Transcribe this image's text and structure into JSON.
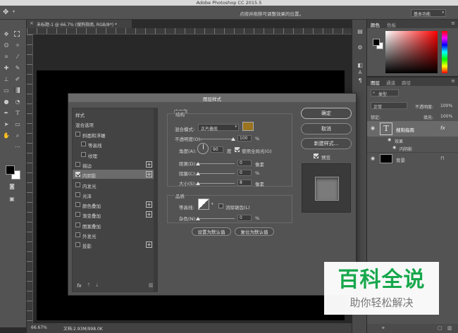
{
  "app": {
    "title": "Adobe Photoshop CC 2015.5",
    "hint": "点按并拖移可调整效果的位置。",
    "workspace": "基本功能"
  },
  "document": {
    "tab": "未标题-1 @ 66.7% (搜狗指南, RGB/8*) *",
    "zoom": "66.67%",
    "status": "文档:2.93M/998.0K"
  },
  "dialog": {
    "title": "图层样式",
    "styles_header": "样式",
    "blend_options": "混合选项",
    "effects": [
      {
        "label": "斜面和浮雕",
        "checked": false,
        "plus": false,
        "indent": false
      },
      {
        "label": "等高线",
        "checked": false,
        "plus": false,
        "indent": true
      },
      {
        "label": "纹理",
        "checked": false,
        "plus": false,
        "indent": true
      },
      {
        "label": "描边",
        "checked": false,
        "plus": true,
        "indent": false
      },
      {
        "label": "内阴影",
        "checked": true,
        "plus": true,
        "indent": false,
        "selected": true
      },
      {
        "label": "内发光",
        "checked": false,
        "plus": false,
        "indent": false
      },
      {
        "label": "光泽",
        "checked": false,
        "plus": false,
        "indent": false
      },
      {
        "label": "颜色叠加",
        "checked": false,
        "plus": true,
        "indent": false
      },
      {
        "label": "渐变叠加",
        "checked": false,
        "plus": true,
        "indent": false
      },
      {
        "label": "图案叠加",
        "checked": false,
        "plus": false,
        "indent": false
      },
      {
        "label": "外发光",
        "checked": false,
        "plus": false,
        "indent": false
      },
      {
        "label": "投影",
        "checked": false,
        "plus": true,
        "indent": false
      }
    ],
    "fx_label": "fx",
    "section_title": "内阴影",
    "structure": "结构",
    "blend_mode_label": "混合模式:",
    "blend_mode_value": "正片叠底",
    "shadow_color": "#9a7420",
    "opacity_label": "不透明度(O):",
    "opacity_value": "100",
    "angle_label": "角度(A):",
    "angle_value": "90",
    "angle_unit": "度",
    "global_light_label": "使用全局光(G)",
    "distance_label": "距离(D):",
    "distance_value": "0",
    "choke_label": "阻塞(C):",
    "choke_value": "0",
    "size_label": "大小(S):",
    "size_value": "8",
    "unit_px": "像素",
    "unit_pct": "%",
    "quality_title": "品质",
    "contour_label": "等高线:",
    "antialias_label": "消除锯齿(L)",
    "noise_label": "杂色(N):",
    "noise_value": "0",
    "set_default": "设置为默认值",
    "reset_default": "复位为默认值",
    "ok": "确定",
    "cancel": "取消",
    "new_style": "新建样式...",
    "preview": "预览"
  },
  "color_panel": {
    "tab1": "颜色",
    "tab2": "色板"
  },
  "layers_panel": {
    "tab1": "图层",
    "tab2": "通道",
    "tab3": "路径",
    "filter": "类型",
    "mode": "正常",
    "opacity_label": "不透明度:",
    "opacity_value": "100%",
    "fill_label": "填充:",
    "fill_value": "100%",
    "lock_label": "锁定:",
    "layers": [
      {
        "name": "搜狗指南",
        "type": "text",
        "fx": "fx"
      },
      {
        "name": "背景",
        "type": "background"
      }
    ],
    "effects_label": "效果",
    "inner_shadow_label": "内阴影"
  },
  "watermark": {
    "title": "百科全说",
    "subtitle": "助你轻松解决"
  }
}
